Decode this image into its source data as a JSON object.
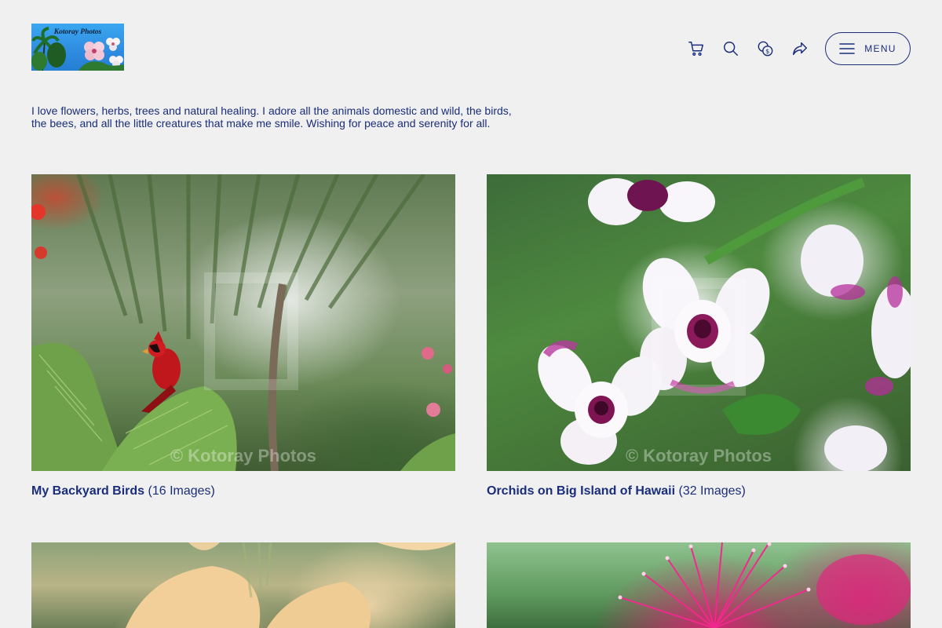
{
  "logo": {
    "title": "Kotoray Photos"
  },
  "header": {
    "icons": [
      "cart-icon",
      "search-icon",
      "currency-icon",
      "share-icon"
    ],
    "menu_label": "MENU"
  },
  "bio": {
    "text": "I love flowers, herbs, trees and natural healing. I adore all the animals domestic and wild, the birds, the bees, and all the little creatures that make me smile. Wishing for peace and serenity for all."
  },
  "galleries": [
    {
      "title": "My Backyard Birds",
      "count": "(16 Images)",
      "watermark": "© Kotoray Photos"
    },
    {
      "title": "Orchids on Big Island of Hawaii",
      "count": "(32 Images)",
      "watermark": "© Kotoray Photos"
    },
    {
      "title": "",
      "count": "",
      "watermark": ""
    },
    {
      "title": "",
      "count": "",
      "watermark": ""
    }
  ],
  "colors": {
    "text": "#1a2d7a",
    "background": "#f0f0f0"
  }
}
